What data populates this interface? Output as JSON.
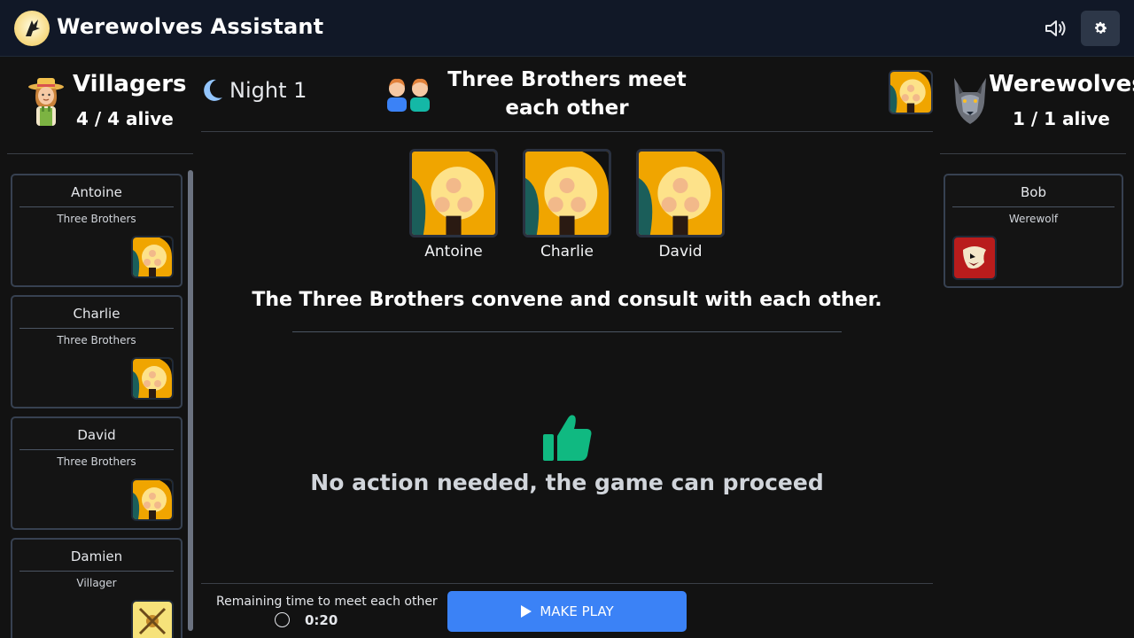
{
  "app": {
    "title": "Werewolves Assistant"
  },
  "header": {
    "sound_icon": "speaker-icon",
    "settings_icon": "gear-icon"
  },
  "villagers": {
    "name": "Villagers",
    "alive": "4 / 4 alive"
  },
  "werewolves": {
    "name": "Werewolves",
    "alive": "1 / 1 alive"
  },
  "phase": {
    "night": "Night 1",
    "title": "Three Brothers meet each other"
  },
  "players": [
    {
      "name": "Antoine",
      "role": "Three Brothers"
    },
    {
      "name": "Charlie",
      "role": "Three Brothers"
    },
    {
      "name": "David",
      "role": "Three Brothers"
    },
    {
      "name": "Damien",
      "role": "Villager"
    }
  ],
  "wolf_players": [
    {
      "name": "Bob",
      "role": "Werewolf"
    }
  ],
  "brothers": [
    "Antoine",
    "Charlie",
    "David"
  ],
  "description": "The Three Brothers convene and consult with each other.",
  "status": "No action needed, the game can proceed",
  "timer": {
    "label": "Remaining time to meet each other",
    "value": "0:20"
  },
  "actions": {
    "make_play": "MAKE PLAY"
  },
  "colors": {
    "accent": "#3b82f6",
    "thumbs": "#10b981",
    "header": "#111827",
    "background": "#121212"
  }
}
